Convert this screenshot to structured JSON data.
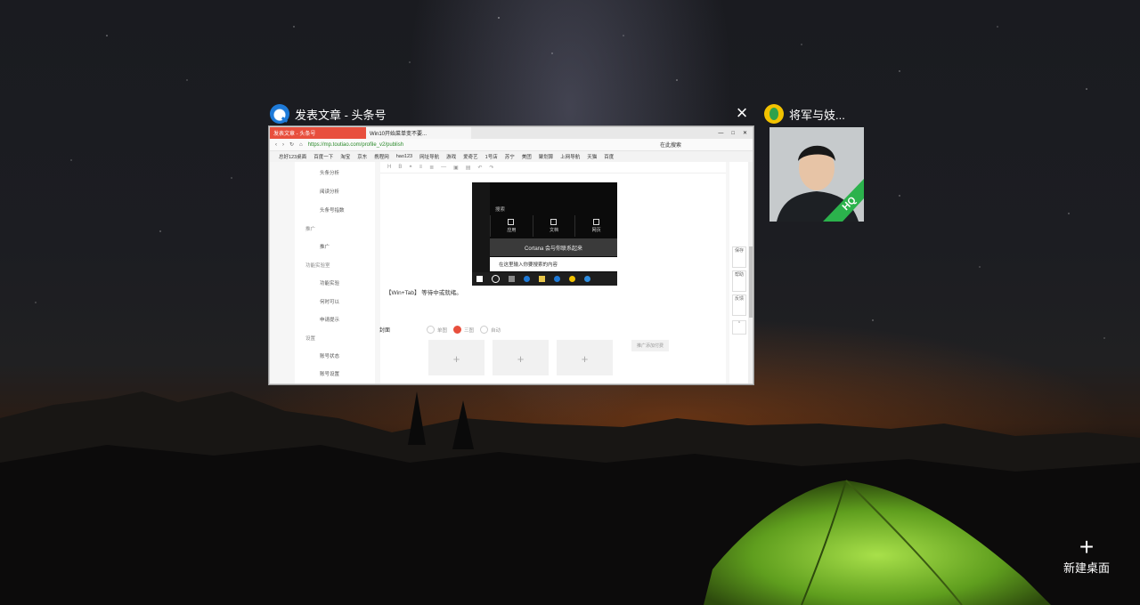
{
  "task_view": {
    "windows": [
      {
        "title": "发表文章 - 头条号",
        "icon": "browser-icon",
        "preview": {
          "tabs": [
            "发表文章 - 头条号",
            "Win10开始菜单变不要..."
          ],
          "address": "https://mp.toutiao.com/profile_v2/publish",
          "search_text": "在此搜索",
          "bookmarks": [
            "总好123桌面",
            "百度一下",
            "淘宝",
            "京东",
            "携程网",
            "hao123",
            "网址导航",
            "游戏",
            "爱奇艺",
            "1号店",
            "苏宁",
            "美团",
            "聚划算",
            "上网导航",
            "天猫",
            "百度"
          ],
          "sidebar": {
            "items": [
              "头条分析",
              "阅读分析",
              "头条号指数"
            ],
            "sections": [
              {
                "heading": "推广",
                "items": [
                  "推广"
                ]
              },
              {
                "heading": "功能实验室",
                "items": [
                  "功能实验",
                  "何时可以",
                  "申请提示"
                ]
              },
              {
                "heading": "设置",
                "items": [
                  "账号状态",
                  "账号设置"
                ]
              }
            ]
          },
          "start_menu": {
            "label": "搜索",
            "tiles": [
              "应用",
              "文档",
              "网页"
            ],
            "cortana": "Cortana 会与你联系起来",
            "search_placeholder": "在这里输入你要搜索的内容"
          },
          "paragraph": "【Win+Tab】 等待中或就绪。",
          "cover_label": "封面",
          "cover_options": [
            "单图",
            "三图",
            "自动"
          ],
          "cover_selected": "三图",
          "upload_slots": [
            "+",
            "+",
            "+"
          ],
          "upload_hint": "推广添加付费",
          "rail": [
            "保存",
            "帮助",
            "反馈"
          ]
        }
      },
      {
        "title": "将军与妓...",
        "icon": "qqmusic-icon",
        "preview_badge": "HQ"
      }
    ],
    "close_label": "×",
    "new_desktop_label": "新建桌面",
    "new_desktop_plus": "+"
  }
}
